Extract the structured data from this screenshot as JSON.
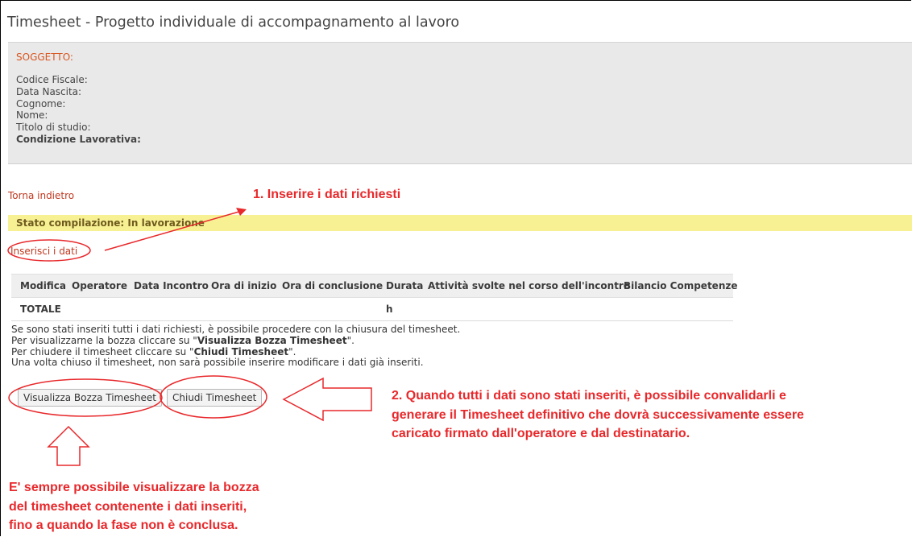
{
  "page": {
    "title": "Timesheet - Progetto individuale di accompagnamento al lavoro"
  },
  "subject": {
    "heading": "SOGGETTO:",
    "fields": [
      "Codice Fiscale:",
      "Data Nascita:",
      "Cognome:",
      "Nome:",
      "Titolo di studio:",
      "Condizione Lavorativa:"
    ]
  },
  "nav": {
    "back_link": "Torna indietro",
    "insert_link": "Inserisci i dati"
  },
  "status": {
    "text": "Stato compilazione: In lavorazione",
    "color": "#f8f194"
  },
  "table": {
    "columns": [
      "Modifica",
      "Operatore",
      "Data Incontro",
      "Ora di inizio",
      "Ora di conclusione",
      "Durata",
      "Attività svolte nel corso dell'incontro",
      "Bilancio Competenze"
    ],
    "total_row": {
      "label": "TOTALE",
      "durata": "h"
    }
  },
  "info": {
    "line1": "Se sono stati inseriti tutti i dati richiesti, è possibile procedere con la chiusura del timesheet.",
    "line2_prefix": "Per visualizzarne la bozza cliccare su \"",
    "line2_bold": "Visualizza Bozza Timesheet",
    "line2_suffix": "\".",
    "line3_prefix": "Per chiudere il timesheet cliccare su \"",
    "line3_bold": "Chiudi Timesheet",
    "line3_suffix": "\".",
    "line4": "Una volta chiuso il timesheet, non sarà possibile inserire modificare i dati già inseriti."
  },
  "buttons": {
    "preview": "Visualizza Bozza Timesheet",
    "close": "Chiudi Timesheet"
  },
  "annotations": {
    "note1": "1. Inserire i dati richiesti",
    "note2_lines": [
      "2. Quando tutti i dati sono stati inseriti, è possibile convalidarli e",
      "generare il Timesheet definitivo che dovrà successivamente essere",
      "caricato firmato dall'operatore e dal destinatario."
    ],
    "note3_lines": [
      "E' sempre possibile visualizzare la bozza",
      "del timesheet contenente i dati inseriti,",
      "fino a quando la fase non è conclusa."
    ],
    "color": "#e8282b"
  }
}
